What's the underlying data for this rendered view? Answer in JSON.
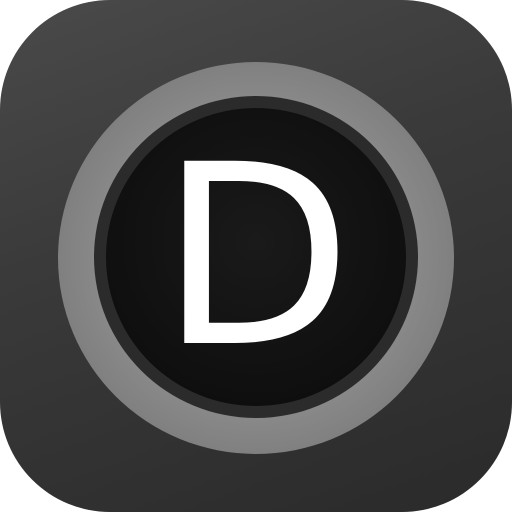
{
  "app_icon": {
    "letter": "D",
    "colors": {
      "tile_light": "#4a4a4a",
      "tile_dark": "#2a2a2a",
      "ring_outer": "#8a8a8a",
      "ring_gap": "#2b2b2b",
      "center": "#0f0f0f",
      "letter": "#ffffff"
    }
  }
}
